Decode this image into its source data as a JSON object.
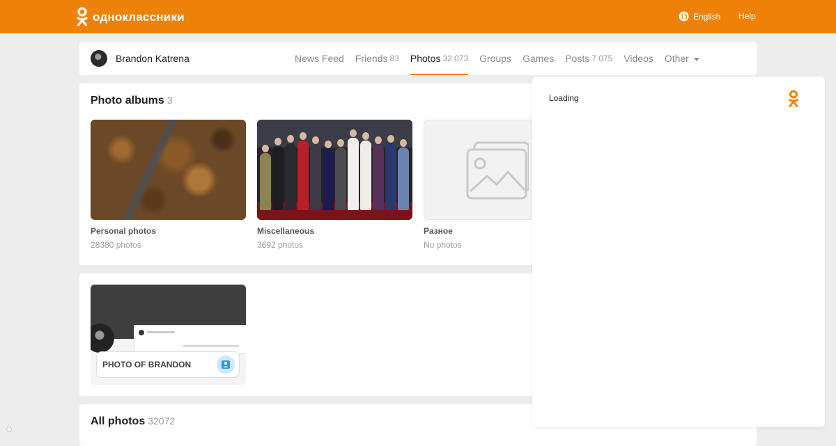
{
  "header": {
    "brand": "одноклассники",
    "language": "English",
    "help": "Help"
  },
  "profile": {
    "name": "Brandon Katrena",
    "tabs": [
      {
        "label": "News Feed",
        "count": ""
      },
      {
        "label": "Friends",
        "count": "83"
      },
      {
        "label": "Photos",
        "count": "32 073"
      },
      {
        "label": "Groups",
        "count": ""
      },
      {
        "label": "Games",
        "count": ""
      },
      {
        "label": "Posts",
        "count": "7 075"
      },
      {
        "label": "Videos",
        "count": ""
      },
      {
        "label": "Other",
        "count": ""
      }
    ],
    "active_tab": "Photos"
  },
  "albums": {
    "title": "Photo albums",
    "count": "3",
    "items": [
      {
        "name": "Personal photos",
        "sub": "28380 photos"
      },
      {
        "name": "Miscellaneous",
        "sub": "3692 photos"
      },
      {
        "name": "Разное",
        "sub": "No photos"
      }
    ]
  },
  "photo_of": {
    "label": "PHOTO OF BRANDON"
  },
  "all_photos": {
    "title": "All photos",
    "count": "32072"
  },
  "overlay": {
    "loading": "Loading"
  },
  "colors": {
    "accent": "#ee8208",
    "page_bg": "#ededed"
  }
}
